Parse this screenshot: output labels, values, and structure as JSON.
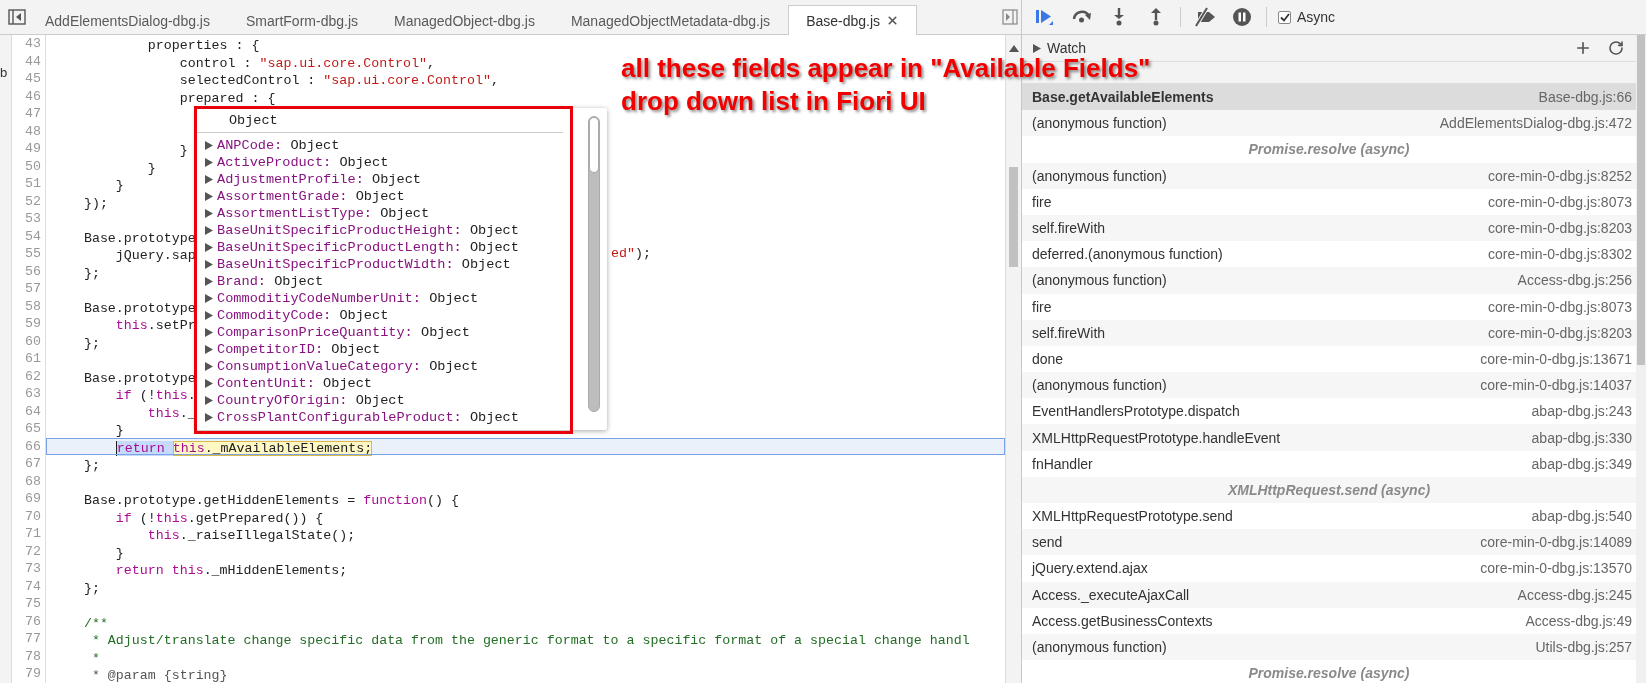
{
  "navigator": {
    "fragment": "b"
  },
  "editor_tabs": [
    {
      "label": "AddElementsDialog-dbg.js",
      "selected": false
    },
    {
      "label": "SmartForm-dbg.js",
      "selected": false
    },
    {
      "label": "ManagedObject-dbg.js",
      "selected": false
    },
    {
      "label": "ManagedObjectMetadata-dbg.js",
      "selected": false
    },
    {
      "label": "Base-dbg.js",
      "selected": true
    }
  ],
  "editor": {
    "lines": [
      {
        "number": "43",
        "current": false,
        "tokens": [
          {
            "text": "            properties : {",
            "kind": "plain"
          }
        ]
      },
      {
        "number": "44",
        "current": false,
        "tokens": [
          {
            "text": "                control : ",
            "kind": "plain"
          },
          {
            "text": "\"sap.ui.core.Control\"",
            "kind": "string"
          },
          {
            "text": ",",
            "kind": "plain"
          }
        ]
      },
      {
        "number": "45",
        "current": false,
        "tokens": [
          {
            "text": "                selectedControl : ",
            "kind": "plain"
          },
          {
            "text": "\"sap.ui.core.Control\"",
            "kind": "string"
          },
          {
            "text": ",",
            "kind": "plain"
          }
        ]
      },
      {
        "number": "46",
        "current": false,
        "tokens": [
          {
            "text": "                prepared : {",
            "kind": "plain"
          }
        ]
      },
      {
        "number": "47",
        "current": false
      },
      {
        "number": "48",
        "current": false
      },
      {
        "number": "49",
        "current": false,
        "tokens": [
          {
            "text": "                }",
            "kind": "plain"
          }
        ]
      },
      {
        "number": "50",
        "current": false,
        "tokens": [
          {
            "text": "            }",
            "kind": "plain"
          }
        ]
      },
      {
        "number": "51",
        "current": false,
        "tokens": [
          {
            "text": "        }",
            "kind": "plain"
          }
        ]
      },
      {
        "number": "52",
        "current": false,
        "tokens": [
          {
            "text": "    });",
            "kind": "plain"
          }
        ]
      },
      {
        "number": "53",
        "current": false
      },
      {
        "number": "54",
        "current": false,
        "tokens": [
          {
            "text": "    Base.prototype",
            "kind": "plain"
          }
        ]
      },
      {
        "number": "55",
        "current": false,
        "tokens": [
          {
            "text": "        jQuery.sap",
            "kind": "plain"
          }
        ],
        "tail": [
          {
            "text": "ed\"",
            "kind": "string"
          },
          {
            "text": ");",
            "kind": "plain"
          }
        ]
      },
      {
        "number": "56",
        "current": false,
        "tokens": [
          {
            "text": "    };",
            "kind": "plain"
          }
        ]
      },
      {
        "number": "57",
        "current": false
      },
      {
        "number": "58",
        "current": false,
        "tokens": [
          {
            "text": "    Base.prototype",
            "kind": "plain"
          }
        ]
      },
      {
        "number": "59",
        "current": false,
        "tokens": [
          {
            "text": "        this",
            "kind": "keyword"
          },
          {
            "text": ".setPr",
            "kind": "plain"
          }
        ]
      },
      {
        "number": "60",
        "current": false,
        "tokens": [
          {
            "text": "    };",
            "kind": "plain"
          }
        ]
      },
      {
        "number": "61",
        "current": false
      },
      {
        "number": "62",
        "current": false,
        "tokens": [
          {
            "text": "    Base.prototype",
            "kind": "plain"
          }
        ]
      },
      {
        "number": "63",
        "current": false,
        "tokens": [
          {
            "text": "        if",
            "kind": "keyword"
          },
          {
            "text": " (!",
            "kind": "plain"
          },
          {
            "text": "this",
            "kind": "keyword"
          },
          {
            "text": ".",
            "kind": "plain"
          }
        ]
      },
      {
        "number": "64",
        "current": false,
        "tokens": [
          {
            "text": "            this",
            "kind": "keyword"
          },
          {
            "text": "._",
            "kind": "plain"
          }
        ]
      },
      {
        "number": "65",
        "current": false,
        "tokens": [
          {
            "text": "        }",
            "kind": "plain"
          }
        ]
      },
      {
        "number": "66",
        "current": true,
        "tokens": [
          {
            "text": "        return ",
            "kind": "keyword",
            "selected": true,
            "evaluated": false
          },
          {
            "text": "this",
            "kind": "keyword",
            "selected": false,
            "evaluated": true
          },
          {
            "text": "._mAvailableElements;",
            "kind": "plain",
            "selected": false,
            "evaluated": true
          }
        ]
      },
      {
        "number": "67",
        "current": false,
        "tokens": [
          {
            "text": "    };",
            "kind": "plain"
          }
        ]
      },
      {
        "number": "68",
        "current": false
      },
      {
        "number": "69",
        "current": false,
        "tokens": [
          {
            "text": "    Base.prototype.getHiddenElements = ",
            "kind": "plain"
          },
          {
            "text": "function",
            "kind": "keyword"
          },
          {
            "text": "() {",
            "kind": "plain"
          }
        ]
      },
      {
        "number": "70",
        "current": false,
        "tokens": [
          {
            "text": "        if",
            "kind": "keyword"
          },
          {
            "text": " (!",
            "kind": "plain"
          },
          {
            "text": "this",
            "kind": "keyword"
          },
          {
            "text": ".getPrepared()) {",
            "kind": "plain"
          }
        ]
      },
      {
        "number": "71",
        "current": false,
        "tokens": [
          {
            "text": "            this",
            "kind": "keyword"
          },
          {
            "text": "._raiseIllegalState();",
            "kind": "plain"
          }
        ]
      },
      {
        "number": "72",
        "current": false,
        "tokens": [
          {
            "text": "        }",
            "kind": "plain"
          }
        ]
      },
      {
        "number": "73",
        "current": false,
        "tokens": [
          {
            "text": "        return ",
            "kind": "keyword"
          },
          {
            "text": "this",
            "kind": "keyword"
          },
          {
            "text": "._mHiddenElements;",
            "kind": "plain"
          }
        ]
      },
      {
        "number": "74",
        "current": false,
        "tokens": [
          {
            "text": "    };",
            "kind": "plain"
          }
        ]
      },
      {
        "number": "75",
        "current": false
      },
      {
        "number": "76",
        "current": false,
        "tokens": [
          {
            "text": "    /**",
            "kind": "comment"
          }
        ]
      },
      {
        "number": "77",
        "current": false,
        "tokens": [
          {
            "text": "     * Adjust/translate change specific data from the generic format to a specific format of a special change handl",
            "kind": "comment"
          }
        ]
      },
      {
        "number": "78",
        "current": false,
        "tokens": [
          {
            "text": "     *",
            "kind": "comment"
          }
        ]
      },
      {
        "number": "79",
        "current": false,
        "tokens": [
          {
            "text": "     * @param {string}",
            "kind": "doc"
          }
        ]
      }
    ]
  },
  "object_popup": {
    "title": "Object",
    "items": [
      {
        "name": "ANPCode:",
        "value": "Object"
      },
      {
        "name": "ActiveProduct:",
        "value": "Object"
      },
      {
        "name": "AdjustmentProfile:",
        "value": "Object"
      },
      {
        "name": "AssortmentGrade:",
        "value": "Object"
      },
      {
        "name": "AssortmentListType:",
        "value": "Object"
      },
      {
        "name": "BaseUnitSpecificProductHeight:",
        "value": "Object"
      },
      {
        "name": "BaseUnitSpecificProductLength:",
        "value": "Object"
      },
      {
        "name": "BaseUnitSpecificProductWidth:",
        "value": "Object"
      },
      {
        "name": "Brand:",
        "value": "Object"
      },
      {
        "name": "CommoditiyCodeNumberUnit:",
        "value": "Object"
      },
      {
        "name": "CommodityCode:",
        "value": "Object"
      },
      {
        "name": "ComparisonPriceQuantity:",
        "value": "Object"
      },
      {
        "name": "CompetitorID:",
        "value": "Object"
      },
      {
        "name": "ConsumptionValueCategory:",
        "value": "Object"
      },
      {
        "name": "ContentUnit:",
        "value": "Object"
      },
      {
        "name": "CountryOfOrigin:",
        "value": "Object"
      },
      {
        "name": "CrossPlantConfigurableProduct:",
        "value": "Object"
      }
    ]
  },
  "annotation": {
    "lines": [
      "all these fields appear in \"Available Fields\"",
      "drop down list in Fiori UI"
    ]
  },
  "debugger_toolbar": {
    "buttons": [
      {
        "kind": "resume"
      },
      {
        "kind": "step-over"
      },
      {
        "kind": "step-into"
      },
      {
        "kind": "step-out"
      },
      {
        "kind": "deactivate-breakpoints"
      },
      {
        "kind": "pause-on-exceptions"
      }
    ],
    "async": {
      "label": "Async",
      "checked": true
    }
  },
  "watch": {
    "title": "Watch",
    "expanded": false
  },
  "call_stack": [
    {
      "kind": "frame",
      "function": "Base.getAvailableElements",
      "location": "Base-dbg.js:66",
      "selected": true
    },
    {
      "kind": "frame",
      "function": "(anonymous function)",
      "location": "AddElementsDialog-dbg.js:472",
      "selected": false
    },
    {
      "kind": "async",
      "label": "Promise.resolve (async)"
    },
    {
      "kind": "frame",
      "function": "(anonymous function)",
      "location": "core-min-0-dbg.js:8252",
      "selected": false
    },
    {
      "kind": "frame",
      "function": "fire",
      "location": "core-min-0-dbg.js:8073",
      "selected": false
    },
    {
      "kind": "frame",
      "function": "self.fireWith",
      "location": "core-min-0-dbg.js:8203",
      "selected": false
    },
    {
      "kind": "frame",
      "function": "deferred.(anonymous function)",
      "location": "core-min-0-dbg.js:8302",
      "selected": false
    },
    {
      "kind": "frame",
      "function": "(anonymous function)",
      "location": "Access-dbg.js:256",
      "selected": false
    },
    {
      "kind": "frame",
      "function": "fire",
      "location": "core-min-0-dbg.js:8073",
      "selected": false
    },
    {
      "kind": "frame",
      "function": "self.fireWith",
      "location": "core-min-0-dbg.js:8203",
      "selected": false
    },
    {
      "kind": "frame",
      "function": "done",
      "location": "core-min-0-dbg.js:13671",
      "selected": false
    },
    {
      "kind": "frame",
      "function": "(anonymous function)",
      "location": "core-min-0-dbg.js:14037",
      "selected": false
    },
    {
      "kind": "frame",
      "function": "EventHandlersPrototype.dispatch",
      "location": "abap-dbg.js:243",
      "selected": false
    },
    {
      "kind": "frame",
      "function": "XMLHttpRequestPrototype.handleEvent",
      "location": "abap-dbg.js:330",
      "selected": false
    },
    {
      "kind": "frame",
      "function": "fnHandler",
      "location": "abap-dbg.js:349",
      "selected": false
    },
    {
      "kind": "async",
      "label": "XMLHttpRequest.send (async)"
    },
    {
      "kind": "frame",
      "function": "XMLHttpRequestPrototype.send",
      "location": "abap-dbg.js:540",
      "selected": false
    },
    {
      "kind": "frame",
      "function": "send",
      "location": "core-min-0-dbg.js:14089",
      "selected": false
    },
    {
      "kind": "frame",
      "function": "jQuery.extend.ajax",
      "location": "core-min-0-dbg.js:13570",
      "selected": false
    },
    {
      "kind": "frame",
      "function": "Access._executeAjaxCall",
      "location": "Access-dbg.js:245",
      "selected": false
    },
    {
      "kind": "frame",
      "function": "Access.getBusinessContexts",
      "location": "Access-dbg.js:49",
      "selected": false
    },
    {
      "kind": "frame",
      "function": "(anonymous function)",
      "location": "Utils-dbg.js:257",
      "selected": false
    },
    {
      "kind": "async",
      "label": "Promise.resolve (async)"
    }
  ]
}
